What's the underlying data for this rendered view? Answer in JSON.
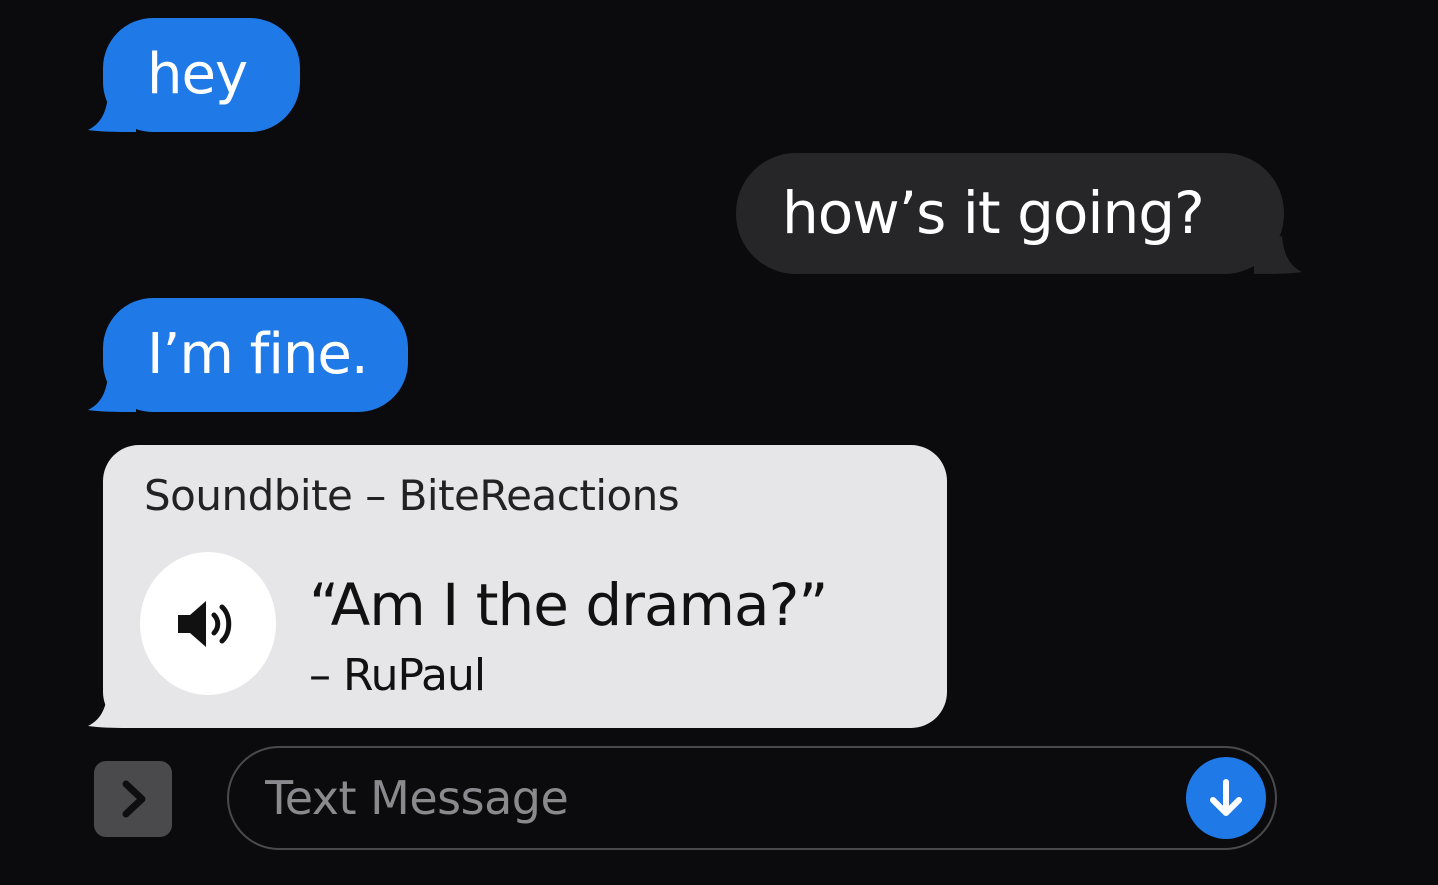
{
  "conversation": {
    "messages": [
      {
        "direction": "incoming",
        "text": "hey"
      },
      {
        "direction": "outgoing",
        "text": "how’s it going?"
      },
      {
        "direction": "incoming",
        "text": "I’m fine."
      }
    ],
    "soundbite": {
      "title": "Soundbite – BiteReactions",
      "quote": "“Am I the drama?”",
      "attribution": "– RuPaul",
      "icon": "speaker-icon"
    }
  },
  "composer": {
    "apps_icon": "chevron-right-icon",
    "placeholder": "Text Message",
    "value": "",
    "send_icon": "arrow-down-icon"
  },
  "colors": {
    "background": "#0b0b0d",
    "incoming_bubble": "#1f7ae8",
    "outgoing_bubble": "#262628",
    "soundbite_card": "#e6e6e8",
    "accent": "#1f7ae8"
  }
}
